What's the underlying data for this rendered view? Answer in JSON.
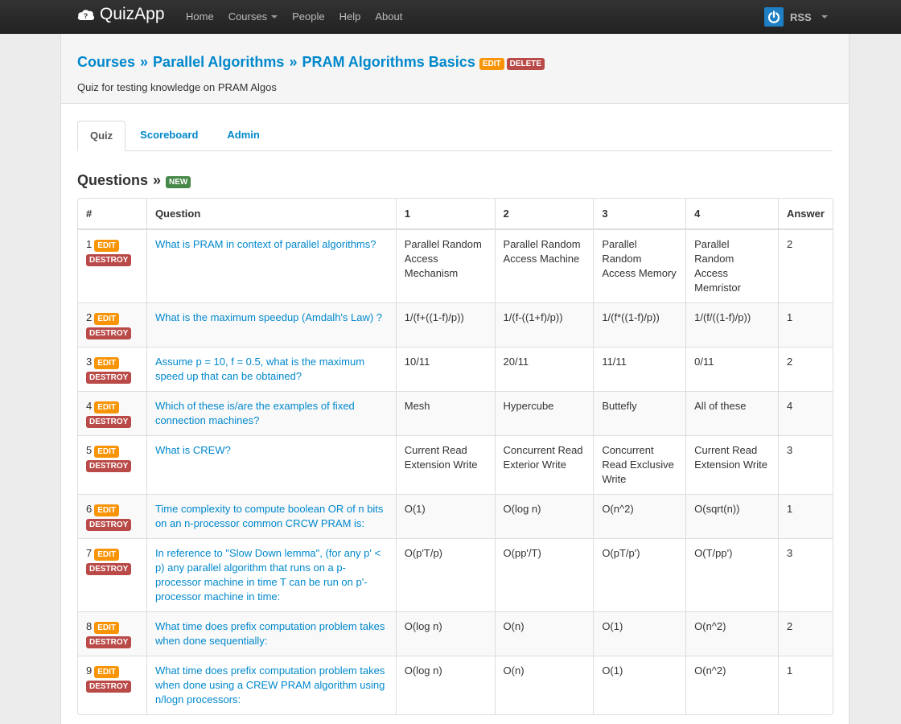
{
  "navbar": {
    "brand": "QuizApp",
    "links": [
      "Home",
      "Courses",
      "People",
      "Help",
      "About"
    ],
    "user": "RSS"
  },
  "header": {
    "crumbs": [
      "Courses",
      "Parallel Algorithms",
      "PRAM Algorithms Basics"
    ],
    "separator": "»",
    "edit_label": "EDIT",
    "delete_label": "DELETE",
    "description": "Quiz for testing knowledge on PRAM Algos"
  },
  "tabs": [
    "Quiz",
    "Scoreboard",
    "Admin"
  ],
  "questions": {
    "title": "Questions",
    "separator": "»",
    "new_label": "NEW",
    "row_edit_label": "EDIT",
    "row_destroy_label": "DESTROY",
    "columns": [
      "#",
      "Question",
      "1",
      "2",
      "3",
      "4",
      "Answer"
    ],
    "rows": [
      {
        "num": "1",
        "question": "What is PRAM in context of parallel algorithms?",
        "o1": "Parallel Random Access Mechanism",
        "o2": "Parallel Random Access Machine",
        "o3": "Parallel Random Access Memory",
        "o4": "Parallel Random Access Memristor",
        "answer": "2"
      },
      {
        "num": "2",
        "question": "What is the maximum speedup (Amdalh's Law) ?",
        "o1": "1/(f+((1-f)/p))",
        "o2": "1/(f-((1+f)/p))",
        "o3": "1/(f*((1-f)/p))",
        "o4": "1/(f/((1-f)/p))",
        "answer": "1"
      },
      {
        "num": "3",
        "question": "Assume p = 10, f = 0.5, what is the maximum speed up that can be obtained?",
        "o1": "10/11",
        "o2": "20/11",
        "o3": "11/11",
        "o4": "0/11",
        "answer": "2"
      },
      {
        "num": "4",
        "question": "Which of these is/are the examples of fixed connection machines?",
        "o1": "Mesh",
        "o2": "Hypercube",
        "o3": "Buttefly",
        "o4": "All of these",
        "answer": "4"
      },
      {
        "num": "5",
        "question": "What is CREW?",
        "o1": "Current Read Extension Write",
        "o2": "Concurrent Read Exterior Write",
        "o3": "Concurrent Read Exclusive Write",
        "o4": "Current Read Extension Write",
        "answer": "3"
      },
      {
        "num": "6",
        "question": "Time complexity to compute boolean OR of n bits on an n-processor common CRCW PRAM is:",
        "o1": "O(1)",
        "o2": "O(log n)",
        "o3": "O(n^2)",
        "o4": "O(sqrt(n))",
        "answer": "1"
      },
      {
        "num": "7",
        "question": "In reference to \"Slow Down lemma\", (for any p' < p) any parallel algorithm that runs on a p-processor machine in time T can be run on p'-processor machine in time:",
        "o1": "O(p'T/p)",
        "o2": "O(pp'/T)",
        "o3": "O(pT/p')",
        "o4": "O(T/pp')",
        "answer": "3"
      },
      {
        "num": "8",
        "question": "What time does prefix computation problem takes when done sequentially:",
        "o1": "O(log n)",
        "o2": "O(n)",
        "o3": "O(1)",
        "o4": "O(n^2)",
        "answer": "2"
      },
      {
        "num": "9",
        "question": "What time does prefix computation problem takes when done using a CREW PRAM algorithm using n/logn processors:",
        "o1": "O(log n)",
        "o2": "O(n)",
        "o3": "O(1)",
        "o4": "O(n^2)",
        "answer": "1"
      }
    ]
  }
}
